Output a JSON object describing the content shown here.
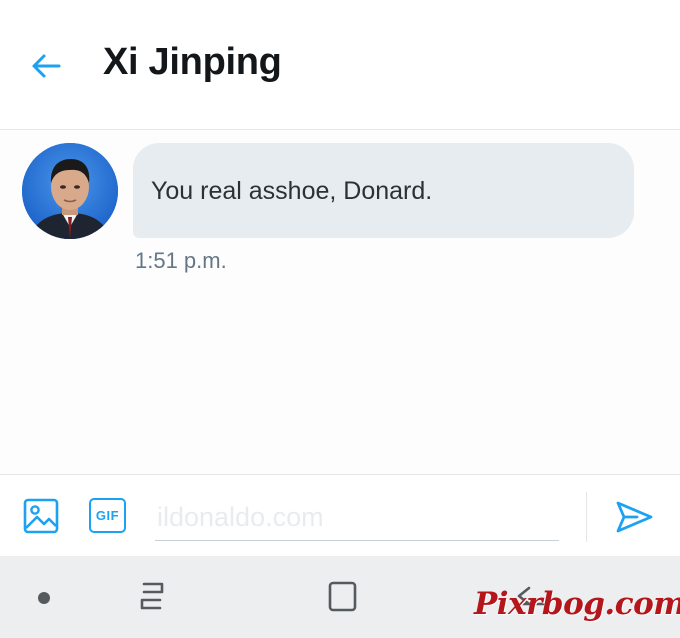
{
  "header": {
    "title": "Xi Jinping",
    "back_icon": "arrow-left-icon"
  },
  "conversation": {
    "avatar_icon": "contact-avatar",
    "messages": [
      {
        "text": "You real asshoe, Donard.",
        "time": "1:51 p.m."
      }
    ]
  },
  "composer": {
    "media_icon": "image-icon",
    "gif_label": "GIF",
    "input_value": "",
    "input_placeholder": "ildonaldo.com",
    "send_icon": "send-icon"
  },
  "navbar": {
    "icons": [
      "dot-icon",
      "recents-icon",
      "home-icon",
      "back-icon"
    ]
  },
  "watermark": "Pixrbog.com",
  "colors": {
    "accent": "#1da1f2",
    "bubble_bg": "#e6ecf0",
    "title_text": "#14171a",
    "secondary_text": "#657786",
    "watermark": "#b5161c"
  }
}
